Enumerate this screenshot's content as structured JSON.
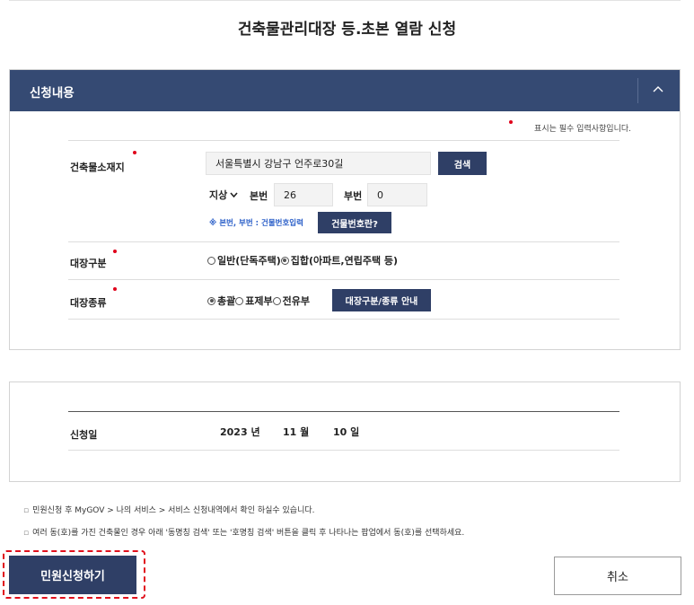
{
  "page": {
    "title": "건축물관리대장 등.초본 열람 신청"
  },
  "section_application": {
    "header_title": "신청내용",
    "required_note": "표시는 필수 입력사항입니다.",
    "address": {
      "label": "건축물소재지",
      "value": "서울특별시 강남구 언주로30길",
      "search_button": "검색",
      "lot_type": "지상",
      "main_no_label": "본번",
      "main_no_value": "26",
      "sub_no_label": "부번",
      "sub_no_value": "0",
      "hint": "※ 본번, 부번 : 건물번호입력",
      "building_no_button": "건물번호란?"
    },
    "ledger_category": {
      "label": "대장구분",
      "options": [
        "일반(단독주택)",
        "집합(아파트,연립주택 등)"
      ],
      "selected": "집합(아파트,연립주택 등)"
    },
    "ledger_type": {
      "label": "대장종류",
      "options": [
        "총괄",
        "표제부",
        "전유부"
      ],
      "selected": "총괄",
      "guide_button": "대장구분/종류 안내"
    }
  },
  "section_date": {
    "label": "신청일",
    "year": "2023",
    "year_unit": "년",
    "month": "11",
    "month_unit": "월",
    "day": "10",
    "day_unit": "일"
  },
  "notices": [
    "민원신청 후 MyGOV > 나의 서비스 > 서비스 신청내역에서 확인 하실수 있습니다.",
    "여러 동(호)를 가진 건축물인 경우 아래 '동명칭 검색' 또는 '호명칭 검색' 버튼을 클릭 후 나타나는 팝업에서 동(호)를 선택하세요."
  ],
  "notice_bullet": "▫",
  "actions": {
    "submit": "민원신청하기",
    "cancel": "취소"
  },
  "colors": {
    "header_navy": "#354a73",
    "button_navy": "#2f3f66",
    "required_red": "#e0001a",
    "hint_blue": "#2b5fc8"
  }
}
